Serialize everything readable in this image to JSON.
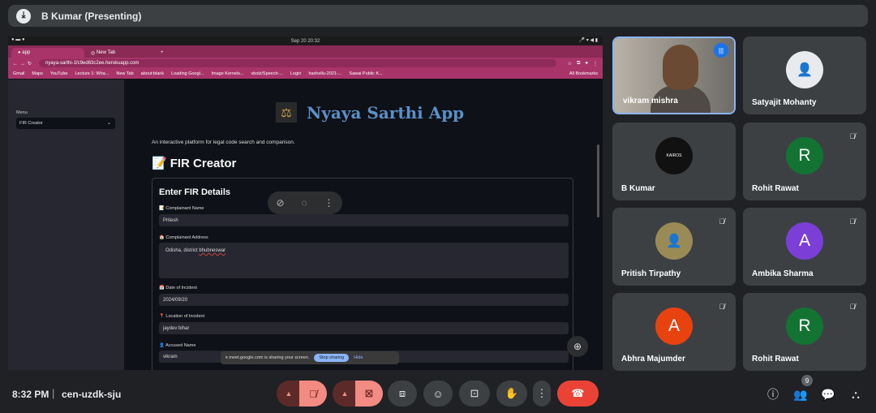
{
  "meeting": {
    "presenter_title": "B Kumar (Presenting)",
    "time": "8:32 PM",
    "code": "cen-uzdk-sju",
    "participant_count": "9"
  },
  "shared_screen": {
    "os_datetime": "Sep 20  20:32",
    "tabs": [
      {
        "label": "app"
      },
      {
        "label": "New Tab"
      }
    ],
    "url": "nyaya-sarthi-1fc9ed63c2ee.herokuapp.com",
    "bookmarks": [
      "Gmail",
      "Maps",
      "YouTube",
      "Lecture 1: Wha...",
      "New Tab",
      "about:blank",
      "Loading Googl...",
      "Image Kernels...",
      "vbolz/Speech-...",
      "Login",
      "haxhellu-2021-...",
      "Sawai Public K..."
    ],
    "all_bookmarks": "All Bookmarks",
    "sidebar": {
      "menu_label": "Menu",
      "selected_option": "FIR Creator"
    },
    "app_title": "Nyaya Sarthi App",
    "tagline": "An interactive platform for legal code search and comparison.",
    "section_title": "FIR Creator",
    "form": {
      "title": "Enter FIR Details",
      "complainant_name_label": "Complainant Name",
      "complainant_name_value": "Pritesh",
      "complainant_address_label": "Complainant Address",
      "complainant_address_value_a": "Odisha, district ",
      "complainant_address_value_b": "bhubneswar",
      "date_label": "Date of Incident",
      "date_value": "2024/09/20",
      "location_label": "Location of Incident",
      "location_value": "jaydev bihar",
      "accused_label": "Accused Name",
      "accused_value": "vikram"
    },
    "share_notice": "meet.google.com is sharing your screen.",
    "stop_sharing": "Stop sharing",
    "hide": "Hide"
  },
  "participants": [
    {
      "name": "vikram mishra",
      "type": "video",
      "speaking": true
    },
    {
      "name": "Satyajit Mohanty",
      "type": "photo",
      "muted": false
    },
    {
      "name": "B Kumar",
      "type": "logo",
      "muted": false
    },
    {
      "name": "Rohit Rawat",
      "initial": "R",
      "color": "#137333",
      "muted": true
    },
    {
      "name": "Pritish Tirpathy",
      "type": "photo",
      "muted": false
    },
    {
      "name": "Ambika Sharma",
      "initial": "A",
      "color": "#7b3fd8",
      "muted": true
    },
    {
      "name": "Abhra Majumder",
      "initial": "A",
      "color": "#e8430f",
      "muted": true
    },
    {
      "name": "Rohit Rawat",
      "initial": "R",
      "color": "#137333",
      "muted": true
    }
  ],
  "colors": {
    "accent": "#8ab4f8",
    "hangup": "#ea4335",
    "muted_control": "#f28b82"
  },
  "icons": {
    "kairos_logo_text": "KAIROS"
  }
}
